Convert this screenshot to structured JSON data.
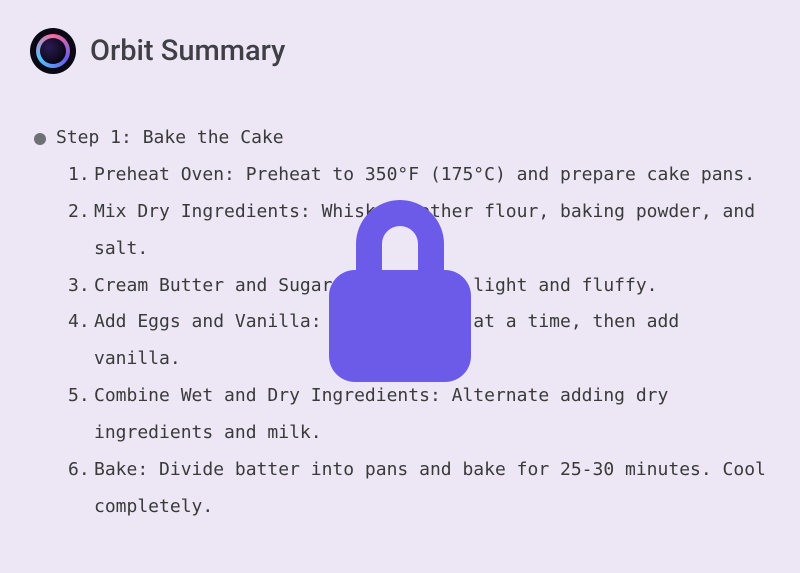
{
  "header": {
    "title": "Orbit Summary"
  },
  "step": {
    "label": "Step 1: Bake the Cake",
    "items": [
      {
        "num": "1.",
        "text": "Preheat Oven: Preheat to 350°F (175°C) and prepare cake pans."
      },
      {
        "num": "2.",
        "text": "Mix Dry Ingredients: Whisk together flour, baking powder, and salt."
      },
      {
        "num": "3.",
        "text": "Cream Butter and Sugar: Beat until light and fluffy."
      },
      {
        "num": "4.",
        "text": "Add Eggs and Vanilla: Add eggs one at a time, then add vanilla."
      },
      {
        "num": "5.",
        "text": "Combine Wet and Dry Ingredients: Alternate adding dry ingredients and milk."
      },
      {
        "num": "6.",
        "text": "Bake: Divide batter into pans and bake for 25-30 minutes. Cool completely."
      }
    ]
  }
}
